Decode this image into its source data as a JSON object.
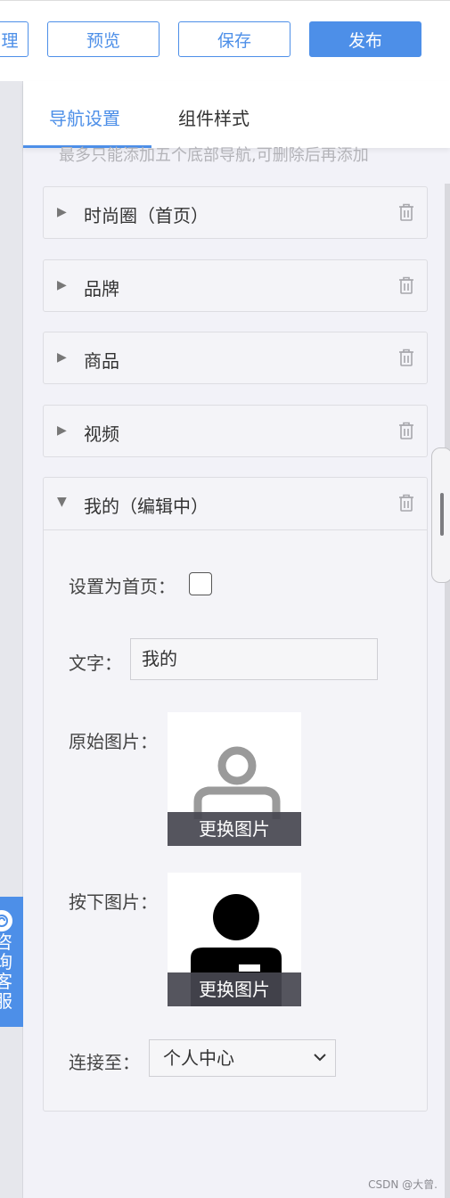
{
  "toolbar": {
    "partial_button": "理",
    "preview": "预览",
    "save": "保存",
    "publish": "发布",
    "accent_color": "#4d8fe8"
  },
  "sidebar": {
    "consult_text": "咨询客服"
  },
  "tabs": [
    {
      "label": "导航设置",
      "active": true
    },
    {
      "label": "组件样式",
      "active": false
    }
  ],
  "hint": "最多只能添加五个底部导航,可删除后再添加",
  "nav_items": [
    {
      "label": "时尚圈（首页）"
    },
    {
      "label": "品牌"
    },
    {
      "label": "商品"
    },
    {
      "label": "视频"
    }
  ],
  "editing_item": {
    "label": "我的（编辑中）",
    "set_home_label": "设置为首页：",
    "set_home_checked": false,
    "text_label": "文字：",
    "text_value": "我的",
    "original_image_label": "原始图片：",
    "pressed_image_label": "按下图片：",
    "change_image": "更换图片",
    "link_label": "连接至：",
    "link_value": "个人中心"
  },
  "watermark": "CSDN @大曾."
}
